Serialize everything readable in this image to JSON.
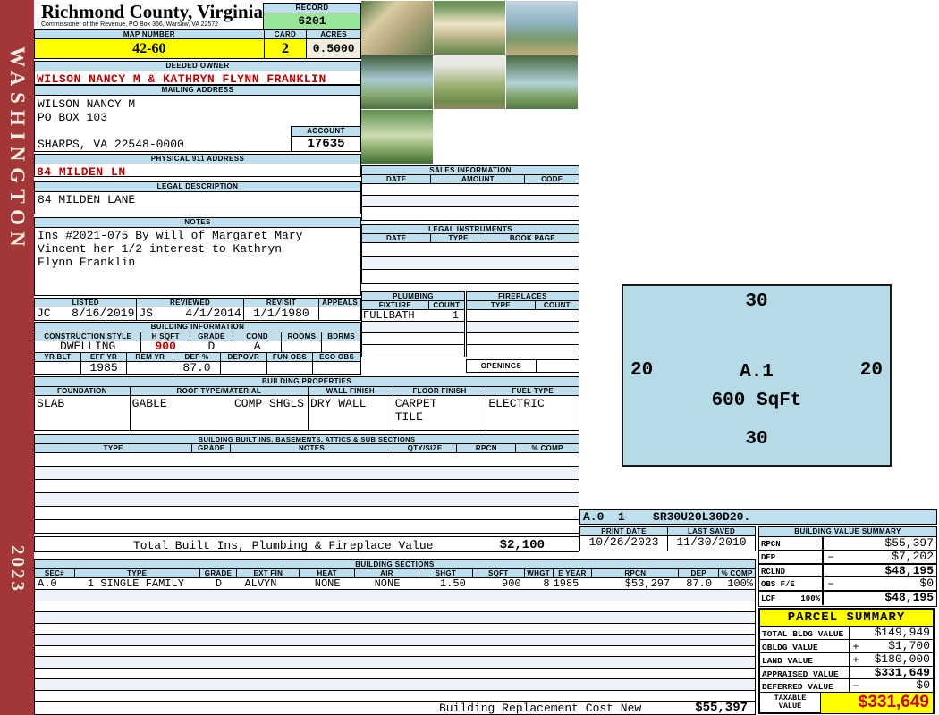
{
  "sidebar": {
    "county": "WASHINGTON",
    "year": "2023"
  },
  "header": {
    "county_title": "Richmond County, Virginia",
    "county_subtitle": "Commissioner of the Revenue, PO Box 366, Warsaw, VA 22572",
    "record_label": "RECORD",
    "record_number": "6201",
    "map_number_label": "MAP NUMBER",
    "map_number": "42-60",
    "card_label": "CARD",
    "card_number": "2",
    "acres_label": "ACRES",
    "acres": "0.5000"
  },
  "owner": {
    "deeded_owner_label": "DEEDED OWNER",
    "deeded_owner": "WILSON NANCY M & KATHRYN FLYNN FRANKLIN",
    "mailing_address_label": "MAILING ADDRESS",
    "mailing_line1": "WILSON NANCY M",
    "mailing_line2": "PO BOX 103",
    "mailing_line3": "SHARPS, VA 22548-0000",
    "account_label": "ACCOUNT",
    "account_number": "17635",
    "physical_address_label": "PHYSICAL 911 ADDRESS",
    "physical_address": "84 MILDEN LN",
    "legal_description_label": "LEGAL DESCRIPTION",
    "legal_description": "84 MILDEN LANE",
    "notes_label": "NOTES",
    "notes_line1": "Ins #2021-075 By will of Margaret Mary",
    "notes_line2": "Vincent her 1/2 interest to Kathryn",
    "notes_line3": "Flynn Franklin"
  },
  "visits": {
    "listed_label": "LISTED",
    "reviewed_label": "REVIEWED",
    "revisit_label": "REVISIT",
    "appeals_label": "APPEALS",
    "listed_by": "JC",
    "listed_date": "8/16/2019",
    "reviewed_by": "JS",
    "reviewed_date": "4/1/2014",
    "revisit_date": "1/1/1980",
    "appeals": ""
  },
  "building_info": {
    "section_label": "BUILDING INFORMATION",
    "construction_style_label": "CONSTRUCTION STYLE",
    "construction_style": "DWELLING",
    "hsqft_label": "H SQFT",
    "hsqft": "900",
    "grade_label": "GRADE",
    "grade": "D",
    "cond_label": "COND",
    "cond": "A",
    "rooms_label": "ROOMS",
    "rooms": "",
    "bdrms_label": "BDRMS",
    "bdrms": "",
    "yr_blt_label": "YR BLT",
    "yr_blt": "",
    "eff_yr_label": "EFF YR",
    "eff_yr": "1985",
    "rem_yr_label": "REM YR",
    "rem_yr": "",
    "dep_pct_label": "DEP %",
    "dep_pct": "87.0",
    "depovr_label": "DEPOVR",
    "depovr": "",
    "fun_obs_label": "FUN OBS",
    "fun_obs": "",
    "eco_obs_label": "ECO OBS",
    "eco_obs": ""
  },
  "building_properties": {
    "section_label": "BUILDING PROPERTIES",
    "foundation_label": "FOUNDATION",
    "foundation": "SLAB",
    "roof_label": "ROOF TYPE/MATERIAL",
    "roof_type": "GABLE",
    "roof_material": "COMP SHGLS",
    "wall_finish_label": "WALL FINISH",
    "wall_finish": "DRY WALL",
    "floor_finish_label": "FLOOR FINISH",
    "floor_finish_line1": "CARPET",
    "floor_finish_line2": "TILE",
    "fuel_type_label": "FUEL TYPE",
    "fuel_type": "ELECTRIC"
  },
  "built_ins": {
    "section_label": "BUILDING BUILT INS, BASEMENTS, ATTICS & SUB SECTIONS",
    "col_type": "TYPE",
    "col_grade": "GRADE",
    "col_notes": "NOTES",
    "col_qty": "QTY/SIZE",
    "col_rpcn": "RPCN",
    "col_comp": "% COMP",
    "total_label": "Total Built Ins, Plumbing & Fireplace Value",
    "total_value": "$2,100"
  },
  "sales": {
    "section_label": "SALES INFORMATION",
    "col_date": "DATE",
    "col_amount": "AMOUNT",
    "col_code": "CODE"
  },
  "legal_instruments": {
    "section_label": "LEGAL INSTRUMENTS",
    "col_date": "DATE",
    "col_type": "TYPE",
    "col_bookpage": "BOOK PAGE"
  },
  "plumbing": {
    "section_label": "PLUMBING",
    "col_fixture": "FIXTURE",
    "col_count": "COUNT",
    "fixture": "FULLBATH",
    "count": "1"
  },
  "fireplaces": {
    "section_label": "FIREPLACES",
    "col_type": "TYPE",
    "col_count": "COUNT",
    "openings_label": "OPENINGS"
  },
  "photos": {
    "count": 7,
    "descriptions": [
      "shed",
      "house front",
      "waterfront dock",
      "house rear",
      "overgrown path",
      "house side",
      "house yard"
    ]
  },
  "sketch": {
    "top_dim": "30",
    "bottom_dim": "30",
    "left_dim": "20",
    "right_dim": "20",
    "section_id": "A.1",
    "area": "600 SqFt",
    "vector_string": "A.0  1    SR30U20L30D20."
  },
  "dates": {
    "print_date_label": "PRINT DATE",
    "print_date": "10/26/2023",
    "last_saved_label": "LAST SAVED",
    "last_saved": "11/30/2010"
  },
  "building_value_summary": {
    "section_label": "BUILDING VALUE SUMMARY",
    "rows": [
      {
        "label": "RPCN",
        "pct": "",
        "sign": "",
        "value": "$55,397"
      },
      {
        "label": "DEP",
        "pct": "",
        "sign": "−",
        "value": "$7,202"
      },
      {
        "label": "RCLND",
        "pct": "",
        "sign": "",
        "value": "$48,195"
      },
      {
        "label": "OBS F/E",
        "pct": "",
        "sign": "−",
        "value": "$0"
      },
      {
        "label": "LCF",
        "pct": "100%",
        "sign": "",
        "value": "$48,195"
      }
    ]
  },
  "building_sections": {
    "section_label": "BUILDING SECTIONS",
    "columns": [
      "SEC#",
      "TYPE",
      "GRADE",
      "EXT FIN",
      "HEAT",
      "AIR",
      "SHGT",
      "SQFT",
      "WHGT",
      "E YEAR",
      "RPCN",
      "DEP",
      "% COMP"
    ],
    "rows": [
      {
        "sec": "A.0",
        "type": "1 SINGLE FAMILY",
        "grade": "D",
        "ext_fin": "ALVYN",
        "heat": "NONE",
        "air": "NONE",
        "shgt": "1.50",
        "sqft": "900",
        "whgt": "8",
        "eyear": "1985",
        "rpcn": "$53,297",
        "dep": "87.0",
        "comp": "100%"
      }
    ],
    "replacement_label": "Building Replacement Cost New",
    "replacement_value": "$55,397"
  },
  "parcel_summary": {
    "section_label": "PARCEL SUMMARY",
    "rows": [
      {
        "label": "TOTAL BLDG VALUE",
        "sign": "",
        "value": "$149,949"
      },
      {
        "label": "OBLDG VALUE",
        "sign": "+",
        "value": "$1,700"
      },
      {
        "label": "LAND VALUE",
        "sign": "+",
        "value": "$180,000"
      },
      {
        "label": "APPRAISED VALUE",
        "sign": "",
        "value": "$331,649"
      },
      {
        "label": "DEFERRED VALUE",
        "sign": "−",
        "value": "$0"
      }
    ],
    "taxable_label_line1": "TAXABLE",
    "taxable_label_line2": "VALUE",
    "taxable_value": "$331,649"
  },
  "colors": {
    "sidebar_red": "#a33636",
    "header_blue": "#bee0ee",
    "highlight_yellow": "#ffff00",
    "record_green": "#98e698",
    "acres_cream": "#f2eedd",
    "sketch_blue": "#b5dbe7",
    "value_red": "#c00000"
  }
}
